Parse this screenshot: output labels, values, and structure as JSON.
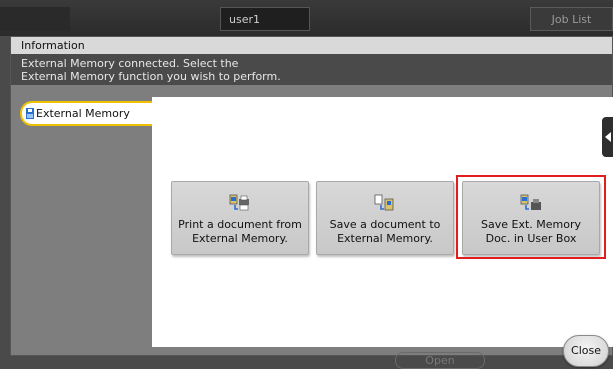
{
  "header": {
    "user": "user1",
    "job_list": "Job List"
  },
  "dialog": {
    "title": "Information",
    "message_line1": "External Memory connected. Select the",
    "message_line2": "External Memory function you wish to perform."
  },
  "tabs": [
    {
      "label": "External Memory",
      "selected": true
    }
  ],
  "functions": [
    {
      "line1": "Print a document from",
      "line2": "External Memory.",
      "icon": "print-from-memory-icon"
    },
    {
      "line1": "Save a document to",
      "line2": "External Memory.",
      "icon": "save-to-memory-icon"
    },
    {
      "line1": "Save Ext. Memory",
      "line2": "Doc. in User Box",
      "icon": "save-to-userbox-icon",
      "highlighted": true
    }
  ],
  "footer": {
    "open_label": "Open",
    "close_label": "Close"
  },
  "colors": {
    "highlight": "#e01e1e",
    "tab_border": "#f0c000",
    "icon_blue": "#2a6fd0"
  }
}
